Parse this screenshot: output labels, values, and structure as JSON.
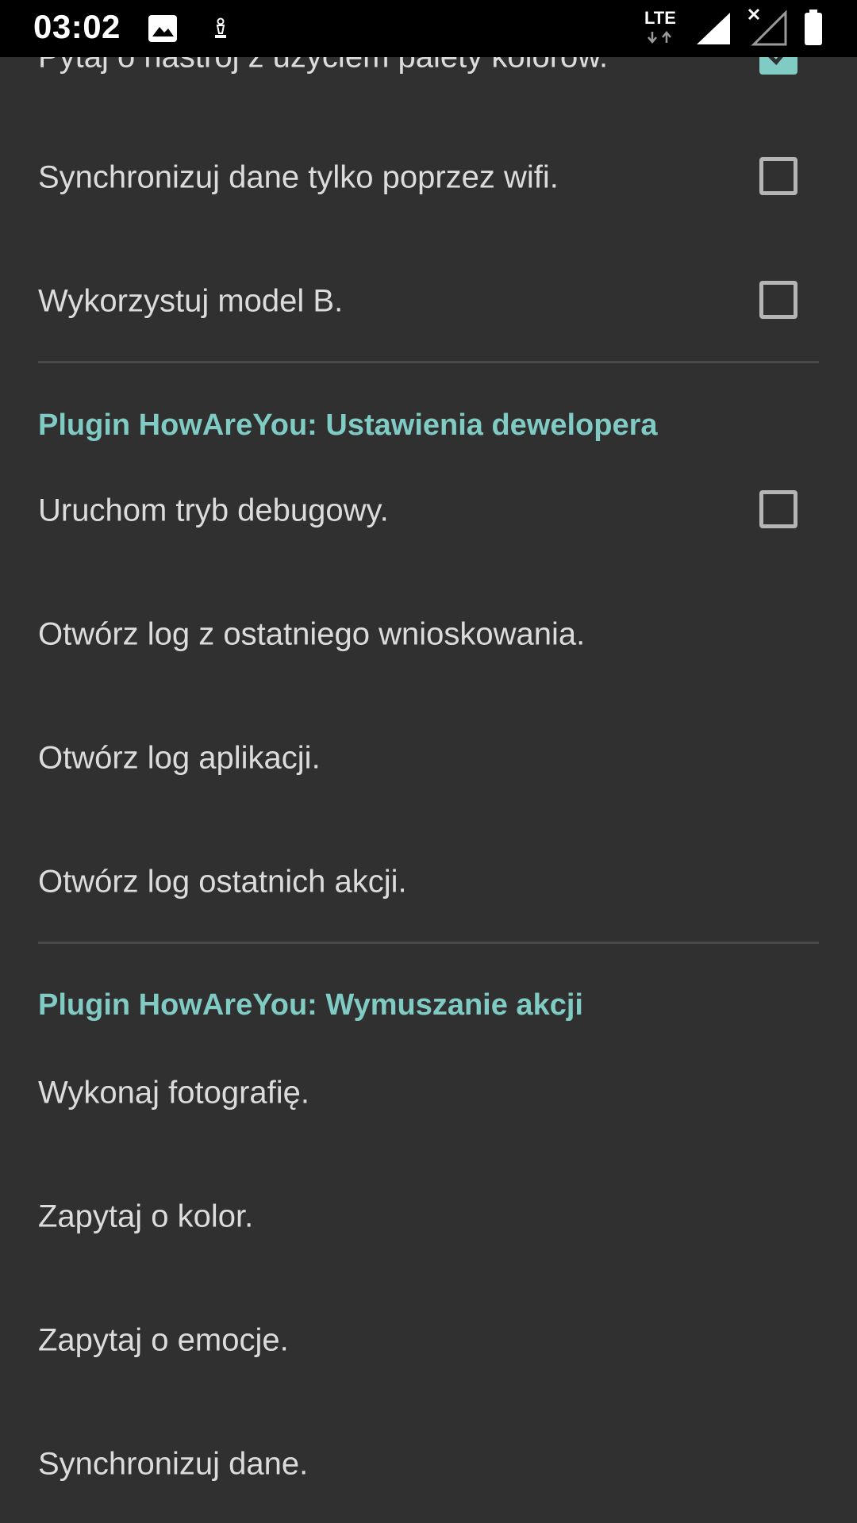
{
  "status_bar": {
    "time": "03:02",
    "network": "LTE"
  },
  "top_partial_item": {
    "label": "Pytaj o nastrój z użyciem palety kolorów.",
    "checked": true
  },
  "settings_items": [
    {
      "label": "Synchronizuj dane tylko poprzez wifi.",
      "checked": false
    },
    {
      "label": "Wykorzystuj model B.",
      "checked": false
    }
  ],
  "developer_section": {
    "title": "Plugin HowAreYou: Ustawienia dewelopera",
    "items": [
      {
        "label": "Uruchom tryb debugowy.",
        "checked": false
      },
      {
        "label": "Otwórz log z ostatniego wnioskowania."
      },
      {
        "label": "Otwórz log aplikacji."
      },
      {
        "label": "Otwórz log ostatnich akcji."
      }
    ]
  },
  "actions_section": {
    "title": "Plugin HowAreYou: Wymuszanie akcji",
    "items": [
      {
        "label": "Wykonaj fotografię."
      },
      {
        "label": "Zapytaj o kolor."
      },
      {
        "label": "Zapytaj o emocje."
      },
      {
        "label": "Synchronizuj dane."
      }
    ]
  },
  "colors": {
    "background": "#303030",
    "accent": "#80cbc4",
    "text": "#dcdcdc"
  }
}
